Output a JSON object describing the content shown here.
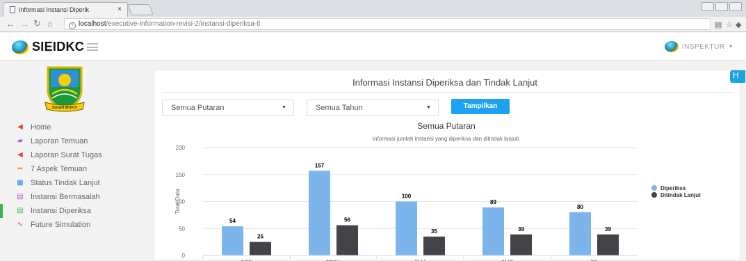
{
  "browser": {
    "tab_title": "Informasi Instansi Diperik",
    "tab_close": "×",
    "url_host": "localhost",
    "url_path": "/executive-information-revisi-2/instansi-diperiksa-tl"
  },
  "header": {
    "brand": "SIEIDKC",
    "user": "INSPEKTUR"
  },
  "sidebar": {
    "crest_motto": "SUGIH MUKTI",
    "items": [
      {
        "label": "Home",
        "icon": "home-icon",
        "color": "#e8452c",
        "glyph": "◀"
      },
      {
        "label": "Laporan Temuan",
        "icon": "folder-icon",
        "color": "#c055d0",
        "glyph": "▰"
      },
      {
        "label": "Laporan Surat Tugas",
        "icon": "send-icon",
        "color": "#e8452c",
        "glyph": "◀"
      },
      {
        "label": "7 Aspek Temuan",
        "icon": "arrow-icon",
        "color": "#f0a030",
        "glyph": "➡"
      },
      {
        "label": "Status Tindak Lanjut",
        "icon": "grid-icon",
        "color": "#1e88e5",
        "glyph": "▦"
      },
      {
        "label": "Instansi Bermasalah",
        "icon": "table-icon",
        "color": "#c055d0",
        "glyph": "▤"
      },
      {
        "label": "Instansi Diperiksa",
        "icon": "table-icon",
        "color": "#3cb54a",
        "glyph": "▤"
      },
      {
        "label": "Future Simulation",
        "icon": "pulse-icon",
        "color": "#e8452c",
        "glyph": "∿"
      }
    ],
    "active_index": 6
  },
  "panel": {
    "title": "Informasi Instansi Diperiksa dan Tindak Lanjut",
    "filter_round": "Semua Putaran",
    "filter_year": "Semua Tahun",
    "show_button": "Tampilkan",
    "side_tab": "H"
  },
  "chart_data": {
    "type": "bar",
    "title": "Semua Putaran",
    "subtitle": "Informasi jumlah instansi yang diperiksa dan ditindak lanjuti.",
    "ylabel": "Total Data",
    "ylim": [
      0,
      200
    ],
    "yticks": [
      0,
      50,
      100,
      150,
      200
    ],
    "categories": [
      "OPD",
      "DESA",
      "SMA",
      "SMP",
      "SD"
    ],
    "series": [
      {
        "name": "Diperiksa",
        "values": [
          54,
          157,
          100,
          89,
          80
        ],
        "color": "#7cb5ec"
      },
      {
        "name": "Ditindak Lanjut",
        "values": [
          25,
          56,
          35,
          39,
          39
        ],
        "color": "#434348"
      }
    ],
    "legend": "right"
  }
}
